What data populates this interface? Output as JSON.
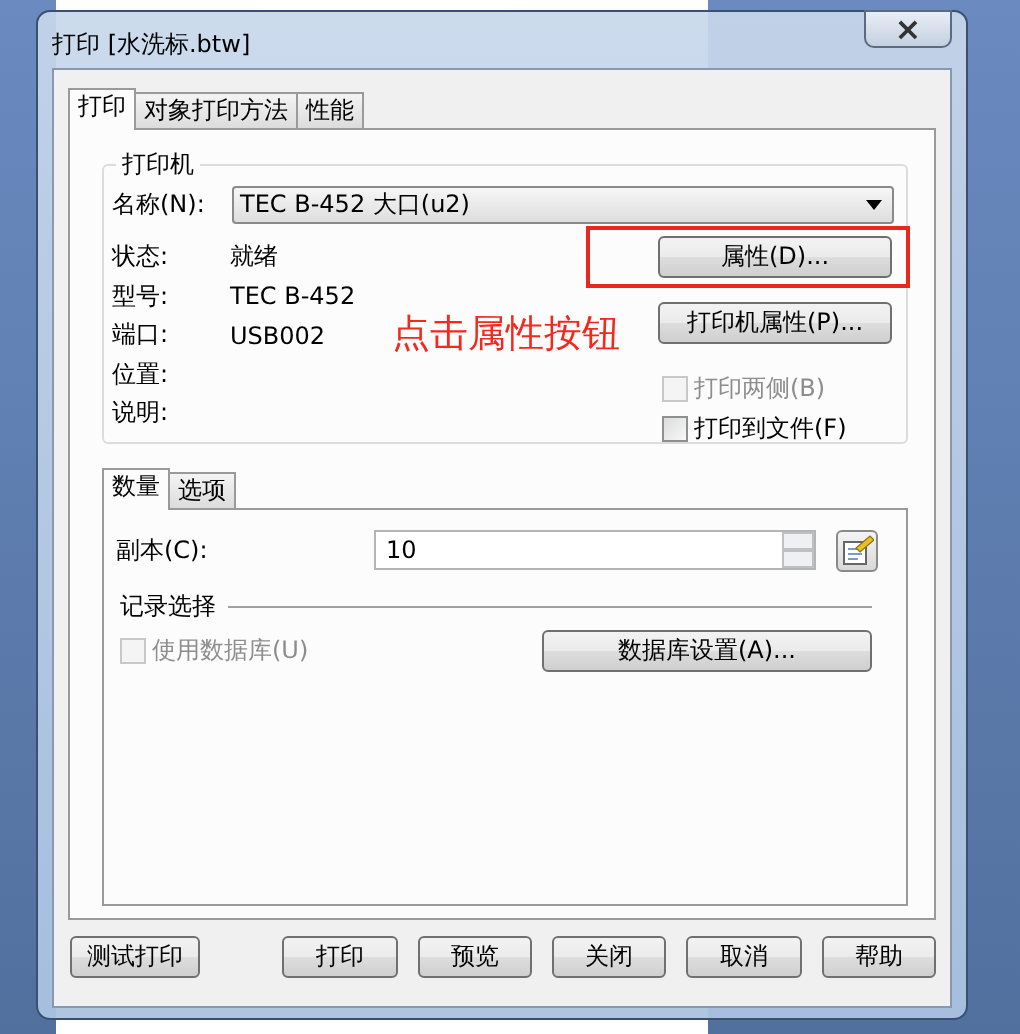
{
  "window": {
    "title": "打印 [水洗标.btw]",
    "close": "×"
  },
  "tabs": [
    {
      "label": "打印",
      "selected": true
    },
    {
      "label": "对象打印方法",
      "selected": false
    },
    {
      "label": "性能",
      "selected": false
    }
  ],
  "printer": {
    "title": "打印机",
    "name_label": "名称(N):",
    "name_value": "TEC B-452 大口(u2)",
    "info": [
      {
        "label": "状态:",
        "value": "就绪"
      },
      {
        "label": "型号:",
        "value": "TEC B-452"
      },
      {
        "label": "端口:",
        "value": "USB002"
      },
      {
        "label": "位置:"
      },
      {
        "label": "说明:"
      }
    ],
    "buttons": [
      {
        "label": "属性(D)...",
        "highlighted": true
      },
      {
        "label": "打印机属性(P)...",
        "highlighted": false
      }
    ],
    "checkboxes": [
      {
        "label": "打印两侧(B)",
        "checked": false,
        "disabled": true
      },
      {
        "label": "打印到文件(F)",
        "checked": false,
        "disabled": false
      }
    ]
  },
  "sub_tabs": [
    {
      "label": "数量",
      "selected": true
    },
    {
      "label": "选项",
      "selected": false
    }
  ],
  "copies": {
    "label": "副本(C):",
    "value": "10"
  },
  "records": {
    "title": "记录选择",
    "checkbox": {
      "label": "使用数据库(U)",
      "checked": false,
      "disabled": true
    },
    "button": "数据库设置(A)..."
  },
  "footer_buttons": [
    {
      "label": "测试打印",
      "kind": "left"
    },
    {
      "label": "打印",
      "kind": "right"
    },
    {
      "label": "预览",
      "kind": "right"
    },
    {
      "label": "关闭",
      "kind": "right"
    },
    {
      "label": "取消",
      "kind": "right"
    },
    {
      "label": "帮助",
      "kind": "right"
    }
  ],
  "annotation": {
    "text": "点击属性按钮"
  }
}
